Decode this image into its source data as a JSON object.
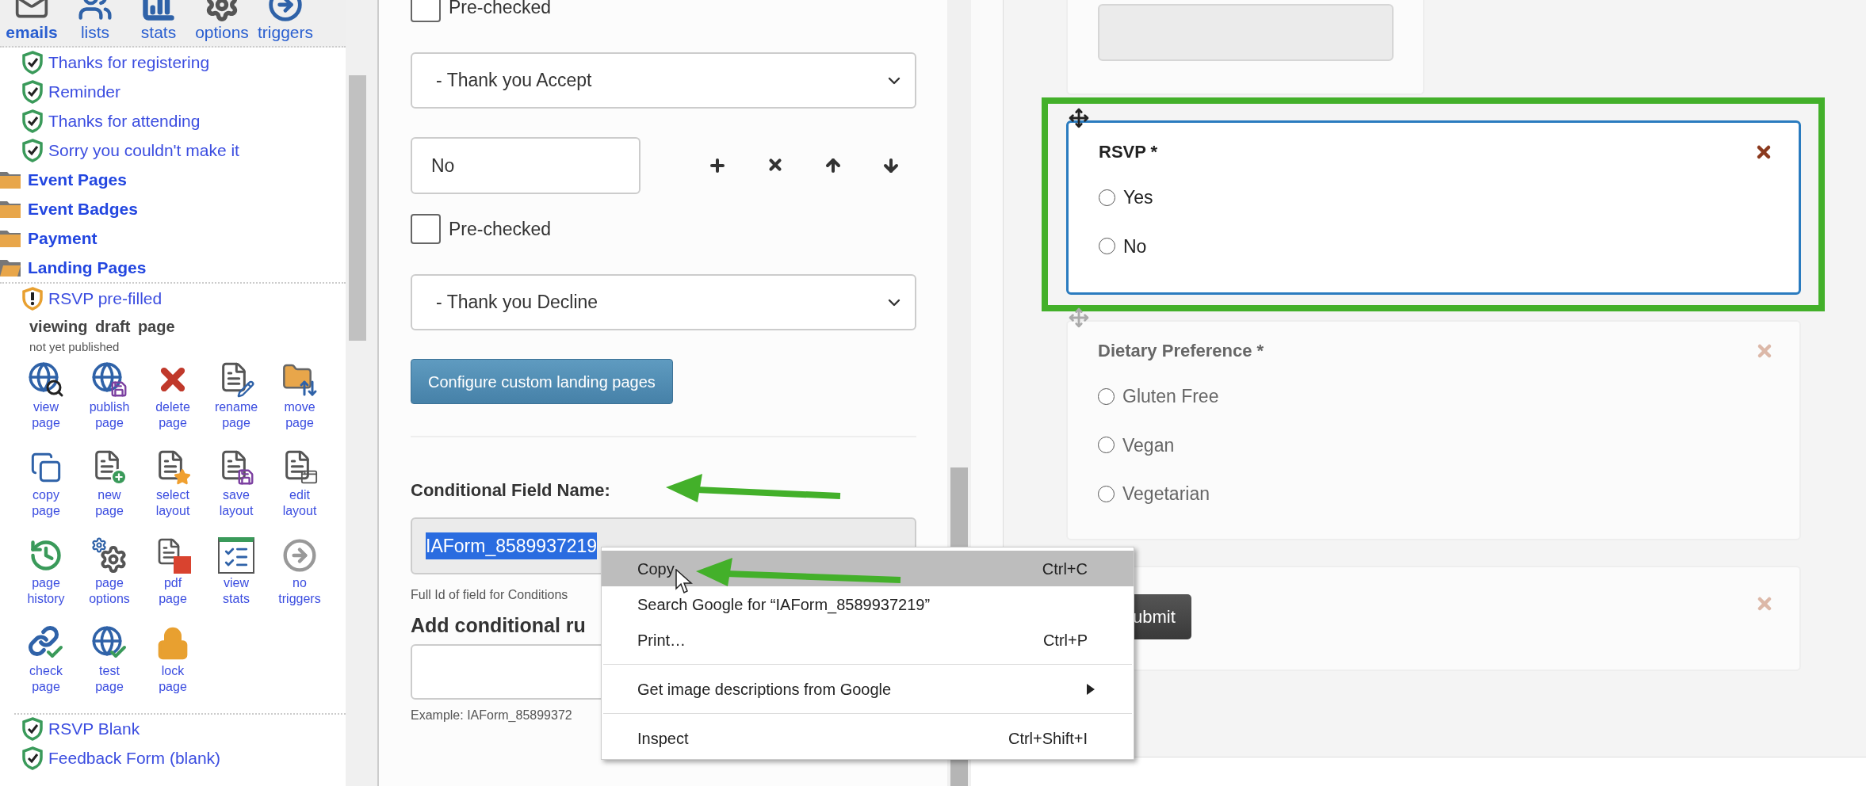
{
  "sidebar": {
    "tabs": [
      {
        "label": "emails",
        "selected": true
      },
      {
        "label": "lists",
        "selected": false
      },
      {
        "label": "stats",
        "selected": false
      },
      {
        "label": "options",
        "selected": false
      },
      {
        "label": "triggers",
        "selected": false
      }
    ],
    "tree": [
      {
        "kind": "page",
        "label": "Thanks for registering",
        "published": true
      },
      {
        "kind": "page",
        "label": "Reminder",
        "published": true
      },
      {
        "kind": "page",
        "label": "Thanks for attending",
        "published": true
      },
      {
        "kind": "page",
        "label": "Sorry you couldn't make it",
        "published": true
      },
      {
        "kind": "folder",
        "label": "Event Pages",
        "expanded": false
      },
      {
        "kind": "folder",
        "label": "Event Badges",
        "expanded": false
      },
      {
        "kind": "folder",
        "label": "Payment",
        "expanded": false
      },
      {
        "kind": "folder",
        "label": "Landing Pages",
        "expanded": true,
        "children": [
          {
            "kind": "page",
            "label": "RSVP pre-filled",
            "published": false,
            "detail": {
              "heading": "viewing draft page",
              "subheading": "not yet published",
              "actions": [
                {
                  "label": "view page"
                },
                {
                  "label": "publish page"
                },
                {
                  "label": "delete page"
                },
                {
                  "label": "rename page"
                },
                {
                  "label": "move page"
                },
                {
                  "label": "copy page"
                },
                {
                  "label": "new page"
                },
                {
                  "label": "select layout"
                },
                {
                  "label": "save layout"
                },
                {
                  "label": "edit layout"
                },
                {
                  "label": "page history"
                },
                {
                  "label": "page options"
                },
                {
                  "label": "pdf page"
                },
                {
                  "label": "view stats"
                },
                {
                  "label": "no triggers"
                },
                {
                  "label": "check page"
                },
                {
                  "label": "test page"
                },
                {
                  "label": "lock page"
                }
              ]
            }
          },
          {
            "kind": "page",
            "label": "RSVP Blank",
            "published": true
          },
          {
            "kind": "page",
            "label": "Feedback Form (blank)",
            "published": true
          }
        ]
      }
    ]
  },
  "editor": {
    "options": [
      {
        "kind": "checkbox",
        "label": "Pre-checked",
        "checked": false
      },
      {
        "kind": "select",
        "value": "- Thank you Accept"
      },
      {
        "kind": "option-row",
        "value": "No"
      },
      {
        "kind": "checkbox",
        "label": "Pre-checked",
        "checked": false
      },
      {
        "kind": "select",
        "value": "- Thank you Decline"
      }
    ],
    "configure_button": "Configure custom landing pages",
    "conditional_label": "Conditional Field Name:",
    "conditional_value": "IAForm_8589937219",
    "conditional_hint": "Full Id of field for Conditions",
    "rules_heading": "Add conditional ru",
    "rules_example": "Example: IAForm_85899372"
  },
  "context_menu": {
    "items": [
      {
        "kind": "item",
        "label": "Copy",
        "shortcut": "Ctrl+C",
        "selected": true
      },
      {
        "kind": "item",
        "label": "Search Google for “IAForm_8589937219”",
        "selected": false
      },
      {
        "kind": "item",
        "label": "Print…",
        "shortcut": "Ctrl+P",
        "selected": false
      },
      {
        "kind": "separator"
      },
      {
        "kind": "submenu",
        "label": "Get image descriptions from Google",
        "selected": false
      },
      {
        "kind": "separator"
      },
      {
        "kind": "item",
        "label": "Inspect",
        "shortcut": "Ctrl+Shift+I",
        "selected": false
      }
    ]
  },
  "form": {
    "fields": [
      {
        "kind": "input"
      },
      {
        "kind": "radio-group",
        "label": "RSVP *",
        "selected": true,
        "options": [
          {
            "label": "Yes",
            "selected": false
          },
          {
            "label": "No",
            "selected": false
          }
        ]
      },
      {
        "kind": "radio-group",
        "label": "Dietary Preference *",
        "selected": false,
        "options": [
          {
            "label": "Gluten Free",
            "selected": false
          },
          {
            "label": "Vegan",
            "selected": false
          },
          {
            "label": "Vegetarian",
            "selected": false
          }
        ]
      },
      {
        "kind": "submit",
        "label": "ubmit"
      }
    ]
  }
}
